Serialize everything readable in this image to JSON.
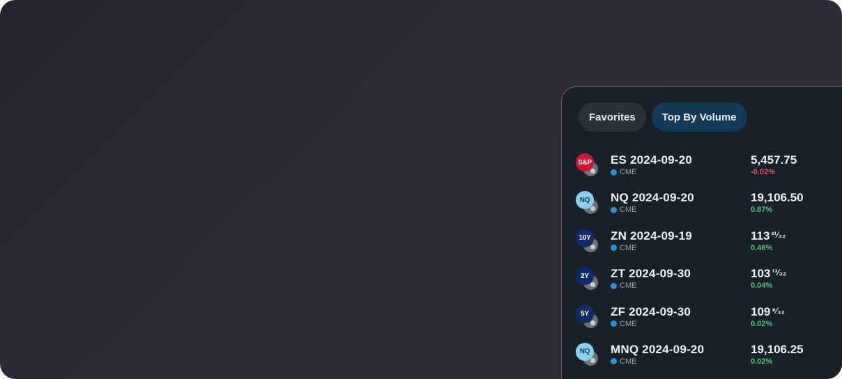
{
  "tabs": [
    {
      "label": "Favorites",
      "active": false
    },
    {
      "label": "Top By Volume",
      "active": true
    }
  ],
  "rows": [
    {
      "icon": "sp-icon",
      "icon_text": "S&P",
      "icon_bg": "#d3143a",
      "icon_fg": "#ffffff",
      "symbol": "ES 2024-09-20",
      "exchange": "CME",
      "price": "5,457.75",
      "price_frac": "",
      "change": "-0.02%",
      "change_color": "#e0506a"
    },
    {
      "icon": "nq-icon",
      "icon_text": "NQ",
      "icon_bg": "#8ad0ee",
      "icon_fg": "#163a5c",
      "symbol": "NQ 2024-09-20",
      "exchange": "CME",
      "price": "19,106.50",
      "price_frac": "",
      "change": "0.87%",
      "change_color": "#5cc17f"
    },
    {
      "icon": "10y-icon",
      "icon_text": "10Y",
      "icon_bg": "#102a6b",
      "icon_fg": "#ffffff",
      "symbol": "ZN 2024-09-19",
      "exchange": "CME",
      "price": "113",
      "price_frac": "²¹⁄₃₂",
      "change": "0.46%",
      "change_color": "#5cc17f"
    },
    {
      "icon": "2y-icon",
      "icon_text": "2Y",
      "icon_bg": "#102a6b",
      "icon_fg": "#ffffff",
      "symbol": "ZT 2024-09-30",
      "exchange": "CME",
      "price": "103",
      "price_frac": "¹³⁄₃₂",
      "change": "0.04%",
      "change_color": "#5cc17f"
    },
    {
      "icon": "5y-icon",
      "icon_text": "5Y",
      "icon_bg": "#102a6b",
      "icon_fg": "#ffffff",
      "symbol": "ZF 2024-09-30",
      "exchange": "CME",
      "price": "109",
      "price_frac": "⁸⁄₃₂",
      "change": "0.02%",
      "change_color": "#5cc17f"
    },
    {
      "icon": "nq-icon",
      "icon_text": "NQ",
      "icon_bg": "#8ad0ee",
      "icon_fg": "#163a5c",
      "symbol": "MNQ 2024-09-20",
      "exchange": "CME",
      "price": "19,106.25",
      "price_frac": "",
      "change": "0.02%",
      "change_color": "#5cc17f"
    }
  ]
}
